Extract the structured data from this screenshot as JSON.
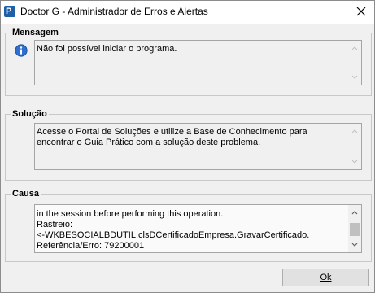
{
  "window": {
    "title": "Doctor G - Administrador de Erros e Alertas",
    "app_icon": "app-logo-icon",
    "close_icon": "close-icon"
  },
  "mensagem": {
    "legend": "Mensagem",
    "icon": "info-icon",
    "text": "Não foi possível iniciar o programa."
  },
  "solucao": {
    "legend": "Solução",
    "text": "Acesse o Portal de Soluções e utilize a Base de Conhecimento para encontrar o Guia Prático com a solução deste problema."
  },
  "causa": {
    "legend": "Causa",
    "text": "in the session before performing this operation.\nRastreio:\n<-WKBESOCIALBDUTIL.clsDCertificadoEmpresa.GravarCertificado.\nReferência/Erro: 79200001"
  },
  "footer": {
    "ok_label": "Ok"
  },
  "colors": {
    "title_bg": "#ffffff",
    "window_bg": "#f0f0f0",
    "icon_blue": "#1f5fa8"
  }
}
